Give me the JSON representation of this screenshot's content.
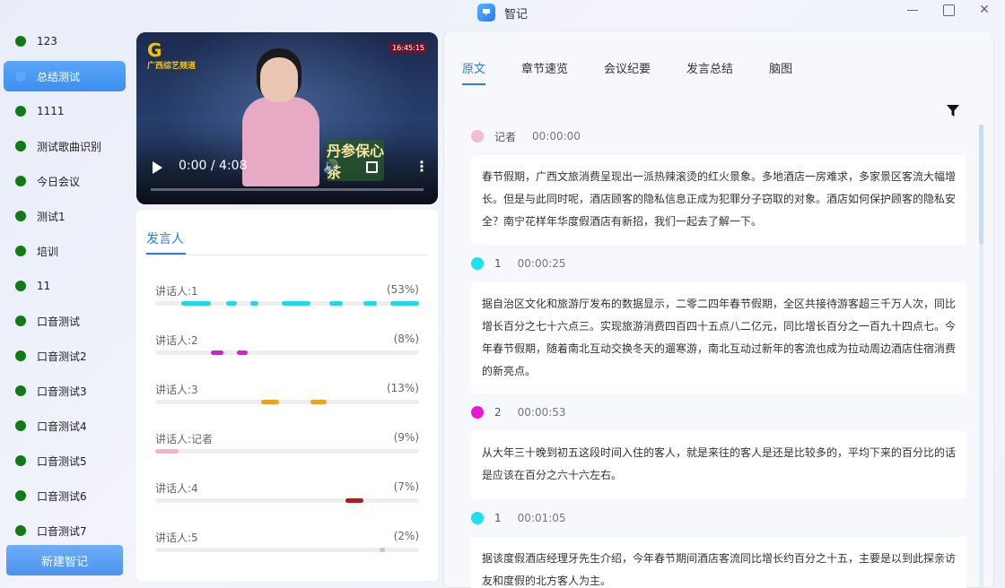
{
  "window": {
    "title": "智记",
    "logo_icon": "app-logo-icon"
  },
  "sidebar": {
    "items": [
      {
        "label": "123",
        "active": false
      },
      {
        "label": "总结测试",
        "active": true
      },
      {
        "label": "1111",
        "active": false
      },
      {
        "label": "测试歌曲识别",
        "active": false
      },
      {
        "label": "今日会议",
        "active": false
      },
      {
        "label": "测试1",
        "active": false
      },
      {
        "label": "培训",
        "active": false
      },
      {
        "label": "11",
        "active": false
      },
      {
        "label": "口音测试",
        "active": false
      },
      {
        "label": "口音测试2",
        "active": false
      },
      {
        "label": "口音测试3",
        "active": false
      },
      {
        "label": "口音测试4",
        "active": false
      },
      {
        "label": "口音测试5",
        "active": false
      },
      {
        "label": "口音测试6",
        "active": false
      },
      {
        "label": "口音测试7",
        "active": false
      }
    ],
    "new_button": "新建智记",
    "dot_color": "#0f7a16"
  },
  "video": {
    "time": "0:00 / 4:08",
    "channel": "广西综艺频道",
    "clock": "16:45:15",
    "badge": "丹参保心茶",
    "progress": 0.0
  },
  "speakers": {
    "tab_label": "发言人",
    "rows": [
      {
        "name": "讲话人:1",
        "pct": "(53%)",
        "color": "#22d8e8",
        "segments": [
          [
            0.1,
            0.21
          ],
          [
            0.27,
            0.31
          ],
          [
            0.36,
            0.39
          ],
          [
            0.48,
            0.59
          ],
          [
            0.66,
            0.71
          ],
          [
            0.79,
            0.84
          ],
          [
            0.89,
            1.0
          ]
        ]
      },
      {
        "name": "讲话人:2",
        "pct": "(8%)",
        "color": "#d41fd0",
        "segments": [
          [
            0.21,
            0.26
          ],
          [
            0.31,
            0.35
          ]
        ]
      },
      {
        "name": "讲话人:3",
        "pct": "(13%)",
        "color": "#f0a020",
        "segments": [
          [
            0.4,
            0.47
          ],
          [
            0.59,
            0.65
          ]
        ]
      },
      {
        "name": "讲话人:记者",
        "pct": "(9%)",
        "color": "#f6b2c6",
        "segments": [
          [
            0.0,
            0.09
          ]
        ]
      },
      {
        "name": "讲话人:4",
        "pct": "(7%)",
        "color": "#a82020",
        "segments": [
          [
            0.72,
            0.79
          ]
        ]
      },
      {
        "name": "讲话人:5",
        "pct": "(2%)",
        "color": "#b5c8e6",
        "segments": [
          [
            0.85,
            0.87
          ]
        ]
      }
    ]
  },
  "transcript": {
    "tabs": [
      "原文",
      "章节速览",
      "会议纪要",
      "发言总结",
      "脑图"
    ],
    "active_tab": 0,
    "filter_icon": "filter-icon",
    "segments": [
      {
        "speaker": "记者",
        "time": "00:00:00",
        "color": "#f6bccc",
        "text": "春节假期，广西文旅消费呈现出一派热辣滚烫的红火景象。多地酒店一房难求，多家景区客流大幅增长。但是与此同时呢，酒店顾客的隐私信息正成为犯罪分子窃取的对象。酒店如何保护顾客的隐私安全？南宁花样年华度假酒店有新招，我们一起去了解一下。"
      },
      {
        "speaker": "1",
        "time": "00:00:25",
        "color": "#1ee0ee",
        "text": "据自治区文化和旅游厅发布的数据显示，二零二四年春节假期，全区共接待游客超三千万人次，同比增长百分之七十六点三。实现旅游消费四百四十五点八二亿元，同比增长百分之一百九十四点七。今年春节假期，随着南北互动交换冬天的遛寒游，南北互动过新年的客流也成为拉动周边酒店住宿消费的新亮点。"
      },
      {
        "speaker": "2",
        "time": "00:00:53",
        "color": "#e619d8",
        "text": "从大年三十晚到初五这段时间入住的客人，就是来往的客人是还是比较多的，平均下来的百分比的话是应该在百分之六十六左右。"
      },
      {
        "speaker": "1",
        "time": "00:01:05",
        "color": "#1ee0ee",
        "text": "据该度假酒店经理牙先生介绍，今年春节期间酒店客流同比增长约百分之十五，主要是以到此探亲访友和度假的北方客人为主。"
      }
    ]
  }
}
